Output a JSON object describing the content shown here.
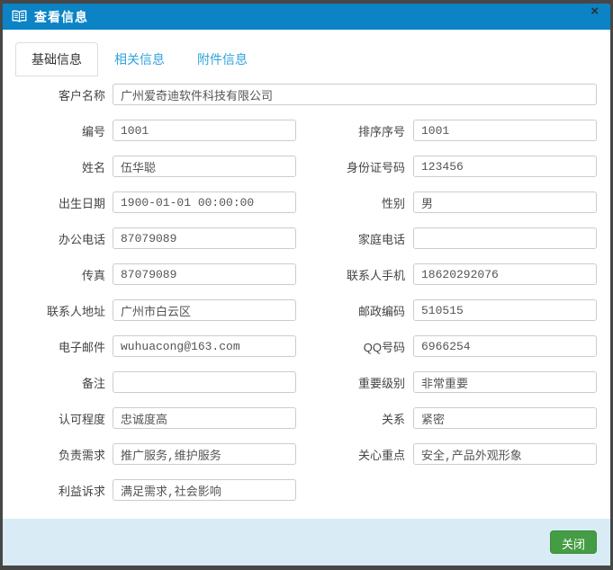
{
  "dialog": {
    "title": "查看信息",
    "close_glyph": "×"
  },
  "tabs": [
    {
      "label": "基础信息",
      "active": true
    },
    {
      "label": "相关信息",
      "active": false
    },
    {
      "label": "附件信息",
      "active": false
    }
  ],
  "form": {
    "rows": [
      {
        "left": {
          "label": "客户名称",
          "value": "广州爱奇迪软件科技有限公司"
        },
        "full_width": true
      },
      {
        "left": {
          "label": "编号",
          "value": "1001"
        },
        "right": {
          "label": "排序序号",
          "value": "1001"
        }
      },
      {
        "left": {
          "label": "姓名",
          "value": "伍华聪"
        },
        "right": {
          "label": "身份证号码",
          "value": "123456"
        }
      },
      {
        "left": {
          "label": "出生日期",
          "value": "1900-01-01 00:00:00"
        },
        "right": {
          "label": "性别",
          "value": "男"
        }
      },
      {
        "left": {
          "label": "办公电话",
          "value": "87079089"
        },
        "right": {
          "label": "家庭电话",
          "value": ""
        }
      },
      {
        "left": {
          "label": "传真",
          "value": "87079089"
        },
        "right": {
          "label": "联系人手机",
          "value": "18620292076"
        }
      },
      {
        "left": {
          "label": "联系人地址",
          "value": "广州市白云区"
        },
        "right": {
          "label": "邮政编码",
          "value": "510515"
        }
      },
      {
        "left": {
          "label": "电子邮件",
          "value": "wuhuacong@163.com"
        },
        "right": {
          "label": "QQ号码",
          "value": "6966254"
        }
      },
      {
        "left": {
          "label": "备注",
          "value": ""
        },
        "right": {
          "label": "重要级别",
          "value": "非常重要"
        }
      },
      {
        "left": {
          "label": "认可程度",
          "value": "忠诚度高"
        },
        "right": {
          "label": "关系",
          "value": "紧密"
        }
      },
      {
        "left": {
          "label": "负责需求",
          "value": "推广服务,维护服务"
        },
        "right": {
          "label": "关心重点",
          "value": "安全,产品外观形象"
        }
      },
      {
        "left": {
          "label": "利益诉求",
          "value": "满足需求,社会影响"
        }
      }
    ]
  },
  "footer": {
    "close_button": "关闭"
  },
  "colors": {
    "titlebar_bg": "#0b83c5",
    "tab_inactive_text": "#31a3db",
    "tab_active_text": "#333333",
    "input_border": "#cccccc",
    "footer_bg": "#d9ecf6",
    "button_bg": "#449d44",
    "button_border": "#3d8b3d",
    "window_frame": "#474747"
  }
}
